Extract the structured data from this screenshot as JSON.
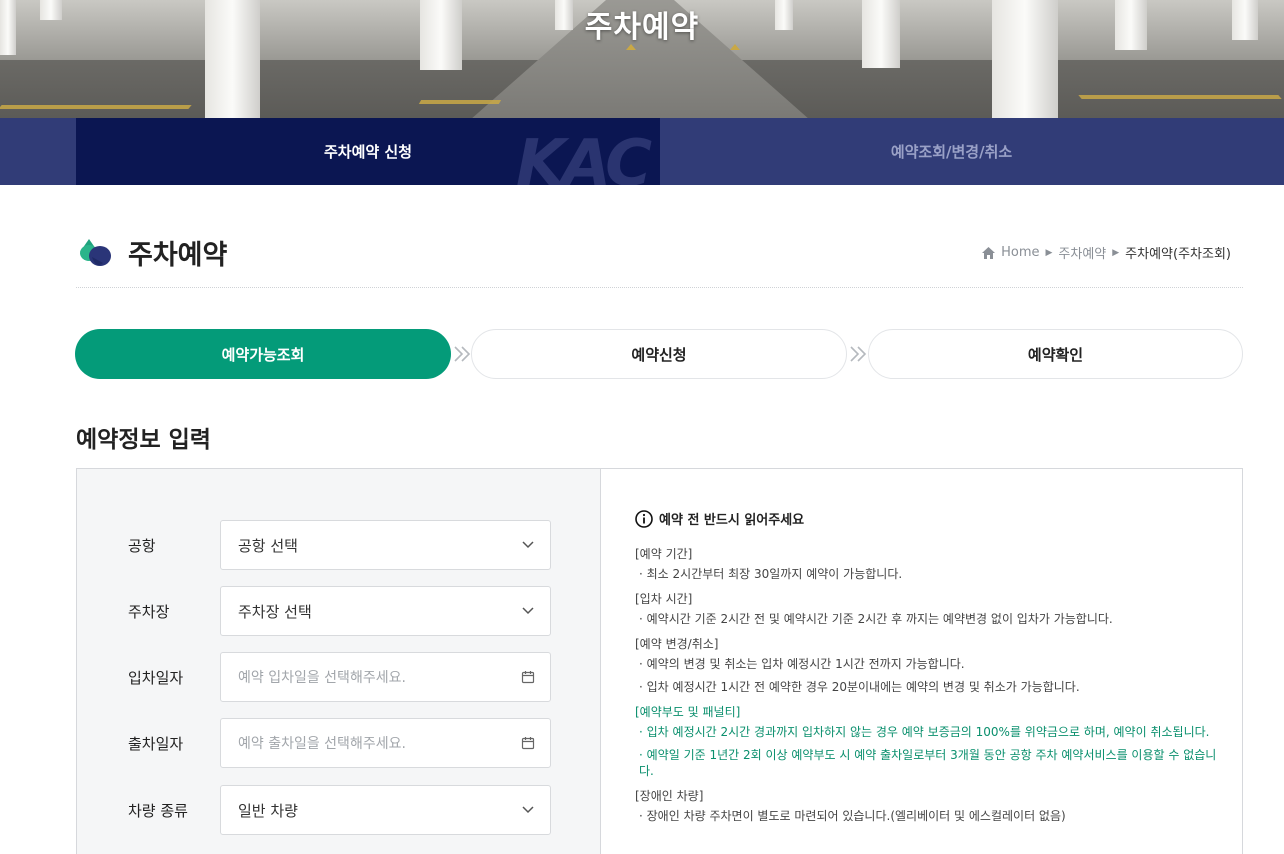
{
  "hero": {
    "title": "주차예약"
  },
  "tabs": [
    {
      "label": "주차예약 신청",
      "active": true
    },
    {
      "label": "예약조회/변경/취소",
      "active": false
    }
  ],
  "tab_watermark": "KAC",
  "page": {
    "title": "주차예약"
  },
  "breadcrumb": {
    "home": "Home",
    "level1": "주차예약",
    "current": "주차예약(주차조회)"
  },
  "steps": [
    {
      "label": "예약가능조회",
      "active": true
    },
    {
      "label": "예약신청",
      "active": false
    },
    {
      "label": "예약확인",
      "active": false
    }
  ],
  "form": {
    "section_title": "예약정보 입력",
    "airport": {
      "label": "공항",
      "value": "공항 선택"
    },
    "parking_lot": {
      "label": "주차장",
      "value": "주차장 선택"
    },
    "entry_date": {
      "label": "입차일자",
      "placeholder": "예약 입차일을 선택해주세요."
    },
    "exit_date": {
      "label": "출차일자",
      "placeholder": "예약 출차일을 선택해주세요."
    },
    "vehicle_type": {
      "label": "차량 종류",
      "value": "일반 차량"
    }
  },
  "notice": {
    "heading": "예약 전 반드시 읽어주세요",
    "groups": [
      {
        "title": "[예약 기간]",
        "items": [
          "· 최소 2시간부터 최장 30일까지 예약이 가능합니다."
        ],
        "highlight": false
      },
      {
        "title": "[입차 시간]",
        "items": [
          "· 예약시간 기준 2시간 전 및 예약시간 기준 2시간 후 까지는 예약변경 없이 입차가 가능합니다."
        ],
        "highlight": false
      },
      {
        "title": "[예약 변경/취소]",
        "items": [
          "· 예약의 변경 및 취소는 입차 예정시간 1시간 전까지 가능합니다.",
          "· 입차 예정시간 1시간 전 예약한 경우 20분이내에는 예약의 변경 및 취소가 가능합니다."
        ],
        "highlight": false
      },
      {
        "title": "[예약부도 및 패널티]",
        "items": [
          "· 입차 예정시간 2시간 경과까지 입차하지 않는 경우 예약 보증금의 100%를 위약금으로 하며, 예약이 취소됩니다.",
          "· 예약일 기준 1년간 2회 이상 예약부도 시 예약 출차일로부터 3개월 동안 공항 주차 예약서비스를 이용할 수 없습니다."
        ],
        "highlight": true
      },
      {
        "title": "[장애인 차량]",
        "items": [
          "· 장애인 차량 주차면이 별도로 마련되어 있습니다.(엘리베이터 및 에스컬레이터 없음)"
        ],
        "highlight": false
      }
    ]
  },
  "colors": {
    "accent_green": "#049b79",
    "navy_active": "#0b1652",
    "navy_bar": "#313c77",
    "notice_green": "#0a8f6d"
  }
}
